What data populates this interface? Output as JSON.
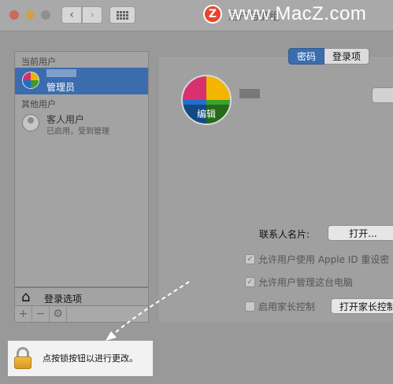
{
  "window": {
    "title": "用户与群组",
    "watermark_text": "www.MacZ.com",
    "watermark_logo_letter": "Z",
    "watermark_color": "#e8452c"
  },
  "sidebar": {
    "current_users_header": "当前用户",
    "admin_user": {
      "role": "管理员"
    },
    "other_users_header": "其他用户",
    "guest_user": {
      "name": "客人用户",
      "status": "已启用，受到管理"
    },
    "login_options_label": "登录选项",
    "bottom_buttons": {
      "add": "+",
      "remove": "−",
      "settings": "⚙"
    }
  },
  "tabs": [
    {
      "label": "密码",
      "active": true
    },
    {
      "label": "登录项",
      "active": false
    }
  ],
  "profile": {
    "edit_label": "编辑",
    "contact_card_label": "联系人名片:",
    "open_button": "打开..."
  },
  "options": [
    {
      "label": "允许用户使用 Apple ID 重设密",
      "checked": true,
      "enabled": false
    },
    {
      "label": "允许用户管理这台电脑",
      "checked": true,
      "enabled": false
    },
    {
      "label": "启用家长控制",
      "checked": false,
      "enabled": false
    }
  ],
  "parental_button": "打开家长控制",
  "lock": {
    "text": "点按锁按钮以进行更改。"
  },
  "colors": {
    "accent": "#3b6cae",
    "lock_gold": "#e0a93a"
  }
}
